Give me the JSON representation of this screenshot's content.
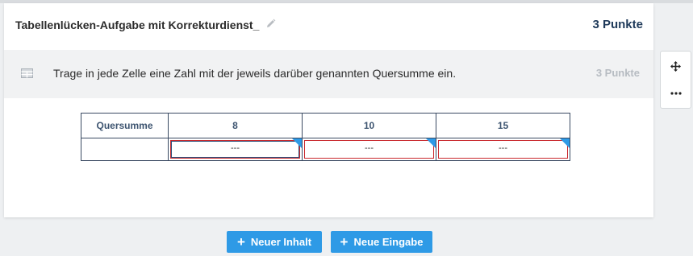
{
  "card": {
    "title": "Tabellenlücken-Aufgabe mit Korrekturdienst_",
    "points": "3 Punkte"
  },
  "task": {
    "icon": "table-icon",
    "text": "Trage in jede Zelle eine Zahl mit der jeweils darüber genannten Quersumme ein.",
    "points": "3 Punkte"
  },
  "table": {
    "header_label": "Quersumme",
    "columns": [
      "8",
      "10",
      "15"
    ],
    "placeholders": [
      "---",
      "---",
      "---"
    ]
  },
  "side_tools": {
    "move_icon": "move-icon",
    "more_icon": "more-icon"
  },
  "buttons": {
    "new_content": "Neuer Inhalt",
    "new_input": "Neue Eingabe"
  },
  "colors": {
    "accent": "#2e9ae6",
    "title_points": "#1f3a5a",
    "gap_border": "#c9282d",
    "header_text": "#3d5470"
  }
}
